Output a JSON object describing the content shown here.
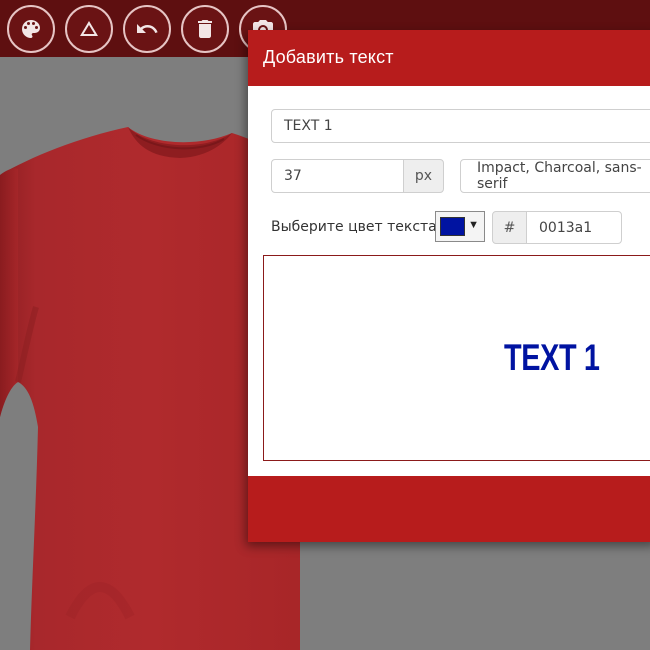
{
  "toolbar": {
    "buttons": [
      {
        "name": "palette-button",
        "icon": "palette-icon"
      },
      {
        "name": "shape-button",
        "icon": "triangle-icon"
      },
      {
        "name": "undo-button",
        "icon": "undo-icon"
      },
      {
        "name": "delete-button",
        "icon": "trash-icon"
      },
      {
        "name": "snapshot-button",
        "icon": "camera-icon"
      }
    ]
  },
  "product": {
    "type": "t-shirt",
    "color": "#b3282b"
  },
  "dialog": {
    "title": "Добавить текст",
    "text_value": "TEXT 1",
    "font_size_value": "37",
    "font_size_unit": "px",
    "font_family_value": "Impact, Charcoal, sans-serif",
    "color_label": "Выберите цвет текста",
    "hex_prefix": "#",
    "hex_value": "0013a1",
    "color": "#0013a1",
    "preview_text": "TEXT 1"
  }
}
